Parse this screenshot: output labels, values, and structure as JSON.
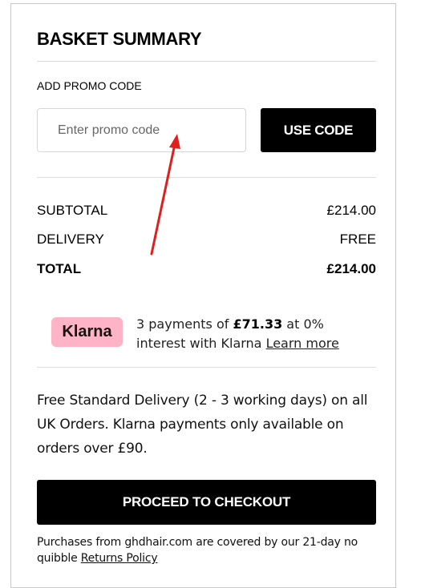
{
  "summary": {
    "title": "BASKET SUMMARY"
  },
  "promo": {
    "label": "ADD PROMO CODE",
    "placeholder": "Enter promo code",
    "button_label": "USE CODE"
  },
  "totals": {
    "subtotal_label": "SUBTOTAL",
    "subtotal_value": "£214.00",
    "delivery_label": "DELIVERY",
    "delivery_value": "FREE",
    "total_label": "TOTAL",
    "total_value": "£214.00"
  },
  "klarna": {
    "logo_text": "Klarna",
    "text_before": "3 payments of ",
    "amount": "£71.33",
    "text_after": " at 0% interest with Klarna ",
    "learn_more": "Learn more",
    "brand_color": "#ffb3c7"
  },
  "delivery_note": "Free Standard Delivery (2 - 3 working days) on all UK Orders. Klarna payments only available on orders over £90.",
  "checkout": {
    "button_label": "PROCEED TO CHECKOUT"
  },
  "footnote": {
    "text": "Purchases from ghdhair.com are covered by our 21-day no quibble ",
    "link": "Returns Policy"
  },
  "annotation": {
    "arrow_color": "#e01e1e",
    "icon": "red-annotation-arrow"
  }
}
